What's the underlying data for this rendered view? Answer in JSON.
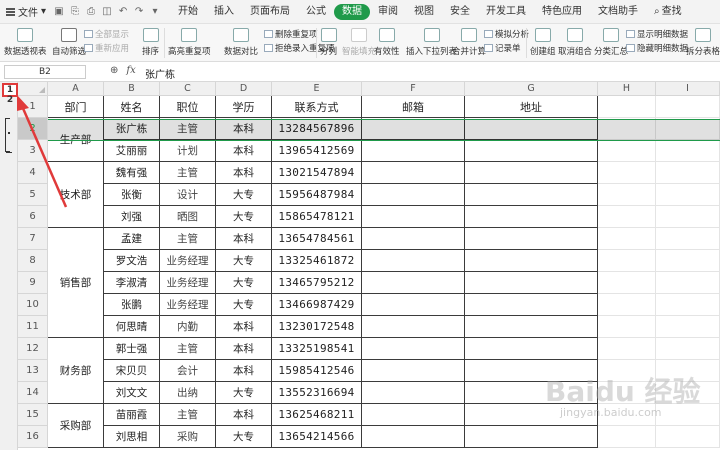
{
  "menubar": {
    "file_label": "文件",
    "tabs": [
      "开始",
      "插入",
      "页面布局",
      "公式",
      "数据",
      "审阅",
      "视图",
      "安全",
      "开发工具",
      "特色应用",
      "文档助手"
    ],
    "active_tab": "数据",
    "search_label": "查找"
  },
  "ribbon": {
    "pivot": "数据透视表",
    "autofilter": "自动筛选",
    "show_all": "全部显示",
    "reapply": "重新应用",
    "sort": "排序",
    "highlight_dup": "高亮重复项",
    "compare": "数据对比",
    "delete_dup": "删除重复项",
    "reject_dup": "拒绝录入重复项",
    "split": "分列",
    "smart_fill": "智能填充",
    "validity": "有效性",
    "dropdown": "插入下拉列表",
    "merge_calc": "合并计算",
    "simulation": "模拟分析",
    "record": "记录单",
    "create_group": "创建组",
    "ungroup": "取消组合",
    "subtotal": "分类汇总",
    "show_detail": "显示明细数据",
    "hide_detail": "隐藏明细数据",
    "split_table": "拆分表格"
  },
  "formula": {
    "cell_ref": "B2",
    "fx": "fx",
    "value": "张广栋"
  },
  "outline": {
    "levels": "1 2"
  },
  "columns": [
    "A",
    "B",
    "C",
    "D",
    "E",
    "F",
    "G",
    "H",
    "I"
  ],
  "rows": [
    "1",
    "2",
    "3",
    "4",
    "5",
    "6",
    "7",
    "8",
    "9",
    "10",
    "11",
    "12",
    "13",
    "14",
    "15",
    "16"
  ],
  "table": {
    "headers": [
      "部门",
      "姓名",
      "职位",
      "学历",
      "联系方式",
      "邮箱",
      "地址"
    ],
    "departments": [
      "生产部",
      "技术部",
      "销售部",
      "财务部",
      "采购部"
    ],
    "records": [
      [
        "张广栋",
        "主管",
        "本科",
        "13284567896"
      ],
      [
        "艾丽丽",
        "计划",
        "本科",
        "13965412569"
      ],
      [
        "魏有强",
        "主管",
        "本科",
        "13021547894"
      ],
      [
        "张衡",
        "设计",
        "大专",
        "15956487984"
      ],
      [
        "刘强",
        "晒图",
        "大专",
        "15865478121"
      ],
      [
        "孟建",
        "主管",
        "本科",
        "13654784561"
      ],
      [
        "罗文浩",
        "业务经理",
        "大专",
        "13325461872"
      ],
      [
        "李淑清",
        "业务经理",
        "大专",
        "13465795212"
      ],
      [
        "张鹏",
        "业务经理",
        "大专",
        "13466987429"
      ],
      [
        "何思晴",
        "内勤",
        "本科",
        "13230172548"
      ],
      [
        "郭士强",
        "主管",
        "本科",
        "13325198541"
      ],
      [
        "宋贝贝",
        "会计",
        "本科",
        "15985412546"
      ],
      [
        "刘文文",
        "出纳",
        "大专",
        "13552316694"
      ],
      [
        "苗丽霞",
        "主管",
        "本科",
        "13625468211"
      ],
      [
        "刘思相",
        "采购",
        "大专",
        "13654214566"
      ]
    ]
  },
  "watermark": {
    "main": "Baidu 经验",
    "sub": "jingyan.baidu.com"
  }
}
